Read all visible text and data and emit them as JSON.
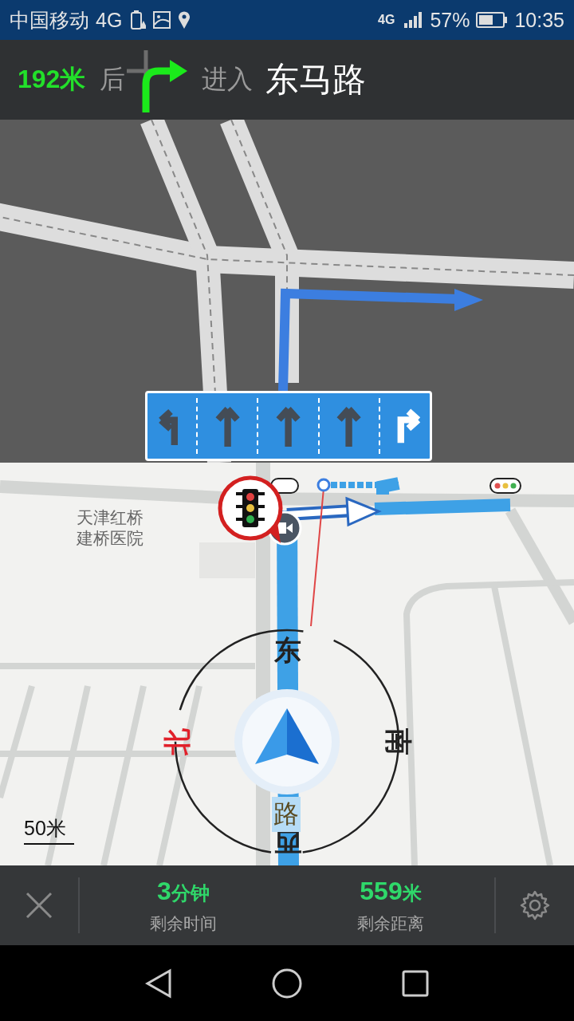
{
  "status_bar": {
    "carrier": "中国移动",
    "network": "4G",
    "data_network": "4G",
    "battery_percent": "57%",
    "time": "10:35"
  },
  "guidance": {
    "distance": "192米",
    "after": "后",
    "action": "进入",
    "road": "东马路"
  },
  "lanes": [
    {
      "kind": "left",
      "selected": false
    },
    {
      "kind": "straight",
      "selected": false
    },
    {
      "kind": "straight",
      "selected": false
    },
    {
      "kind": "straight",
      "selected": false
    },
    {
      "kind": "right",
      "selected": true
    }
  ],
  "map": {
    "poi_label": "天津红桥建桥医院",
    "road_label": "路",
    "scale": "50米"
  },
  "compass": [
    {
      "kind": "east",
      "label": "东"
    },
    {
      "kind": "north",
      "label": "北"
    },
    {
      "kind": "south",
      "label": "南"
    },
    {
      "kind": "west",
      "label": "西"
    }
  ],
  "trip": {
    "time_value": "3",
    "time_unit": "分钟",
    "time_label": "剩余时间",
    "distance_value": "559",
    "distance_unit": "米",
    "distance_label": "剩余距离"
  }
}
